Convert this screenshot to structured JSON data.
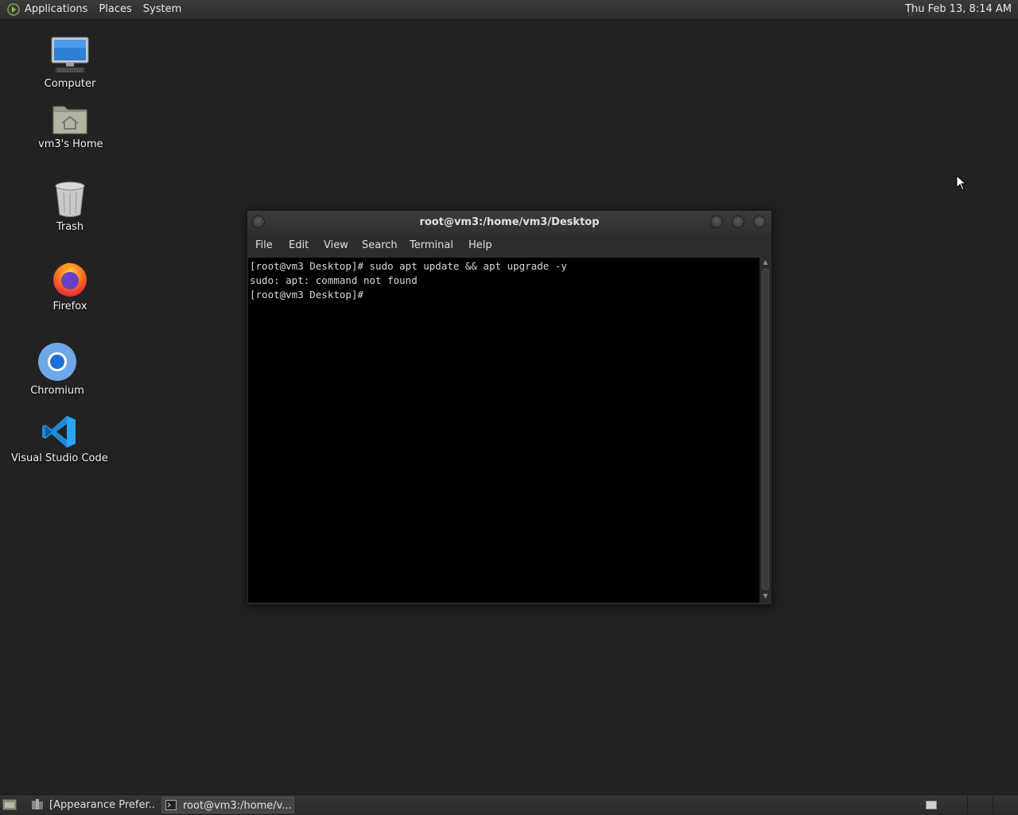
{
  "top_panel": {
    "menus": [
      "Applications",
      "Places",
      "System"
    ],
    "clock": "Thu Feb 13,  8:14 AM"
  },
  "desktop": {
    "icons": [
      {
        "label": "Computer",
        "icon": "computer-icon"
      },
      {
        "label": "vm3's Home",
        "icon": "home-folder-icon"
      },
      {
        "label": "Trash",
        "icon": "trash-icon"
      },
      {
        "label": "Firefox",
        "icon": "firefox-icon"
      },
      {
        "label": "Chromium",
        "icon": "chromium-icon"
      },
      {
        "label": "Visual Studio Code",
        "icon": "vscode-icon"
      }
    ]
  },
  "terminal": {
    "title": "root@vm3:/home/vm3/Desktop",
    "menu": [
      "File",
      "Edit",
      "View",
      "Search",
      "Terminal",
      "Help"
    ],
    "lines": [
      "[root@vm3 Desktop]# sudo apt update && apt upgrade -y",
      "sudo: apt: command not found",
      "[root@vm3 Desktop]# "
    ]
  },
  "taskbar": {
    "tasks": [
      {
        "label": "[Appearance Prefer...",
        "active": false
      },
      {
        "label": "root@vm3:/home/v...",
        "active": true
      }
    ]
  },
  "colors": {
    "desktop_bg": "#222222",
    "terminal_bg": "#000000",
    "terminal_fg": "#d8d8d8"
  }
}
